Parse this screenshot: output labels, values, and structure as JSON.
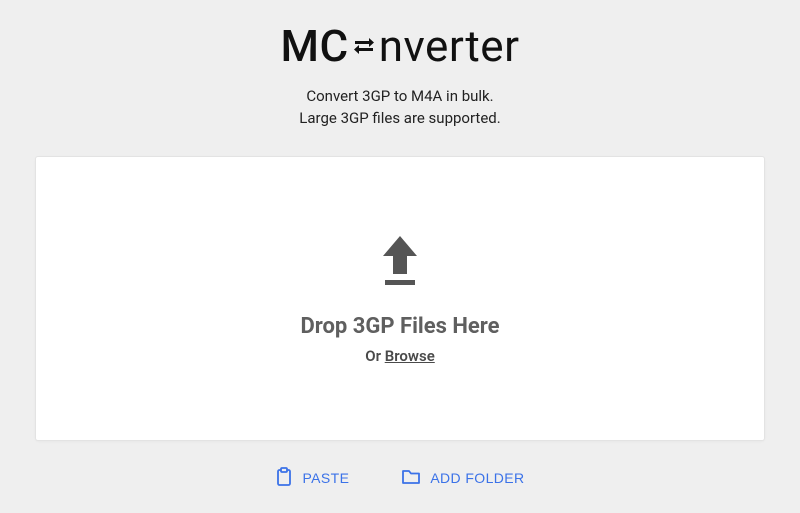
{
  "logo": {
    "prefix": "MC",
    "suffix": "nverter"
  },
  "subtitle": {
    "line1": "Convert 3GP to M4A in bulk.",
    "line2": "Large 3GP files are supported."
  },
  "dropzone": {
    "title": "Drop 3GP Files Here",
    "or_prefix": "Or ",
    "browse_label": "Browse"
  },
  "actions": {
    "paste_label": "PASTE",
    "add_folder_label": "ADD FOLDER"
  }
}
